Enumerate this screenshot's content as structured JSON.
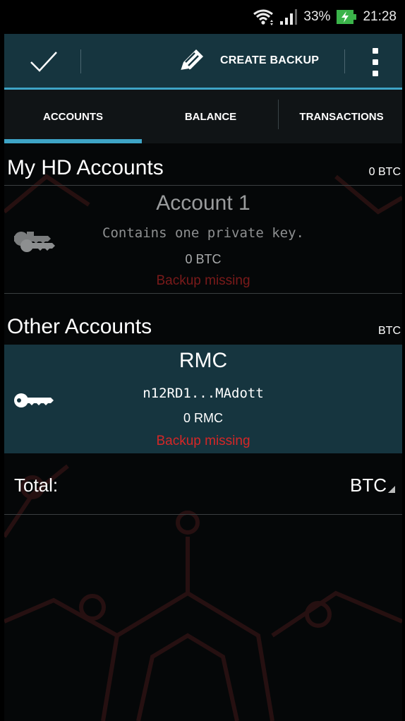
{
  "status_bar": {
    "battery": "33%",
    "time": "21:28"
  },
  "action_bar": {
    "create_backup_label": "CREATE BACKUP"
  },
  "tabs": [
    {
      "label": "ACCOUNTS",
      "selected": true
    },
    {
      "label": "BALANCE",
      "selected": false
    },
    {
      "label": "TRANSACTIONS",
      "selected": false
    }
  ],
  "hd_section": {
    "title": "My HD Accounts",
    "total": "0 BTC"
  },
  "hd_account": {
    "name": "Account 1",
    "description": "Contains one private key.",
    "balance": "0 BTC",
    "warning": "Backup missing"
  },
  "other_section": {
    "title": "Other Accounts",
    "total": "BTC"
  },
  "other_account": {
    "name": "RMC",
    "address": "n12RD1...MAdott",
    "balance": "0 RMC",
    "warning": "Backup missing"
  },
  "total": {
    "label": "Total:",
    "value": "BTC"
  },
  "colors": {
    "action_bar": "#16353f",
    "accent": "#3ea4c6",
    "warning": "#d42727",
    "background": "#050708"
  }
}
